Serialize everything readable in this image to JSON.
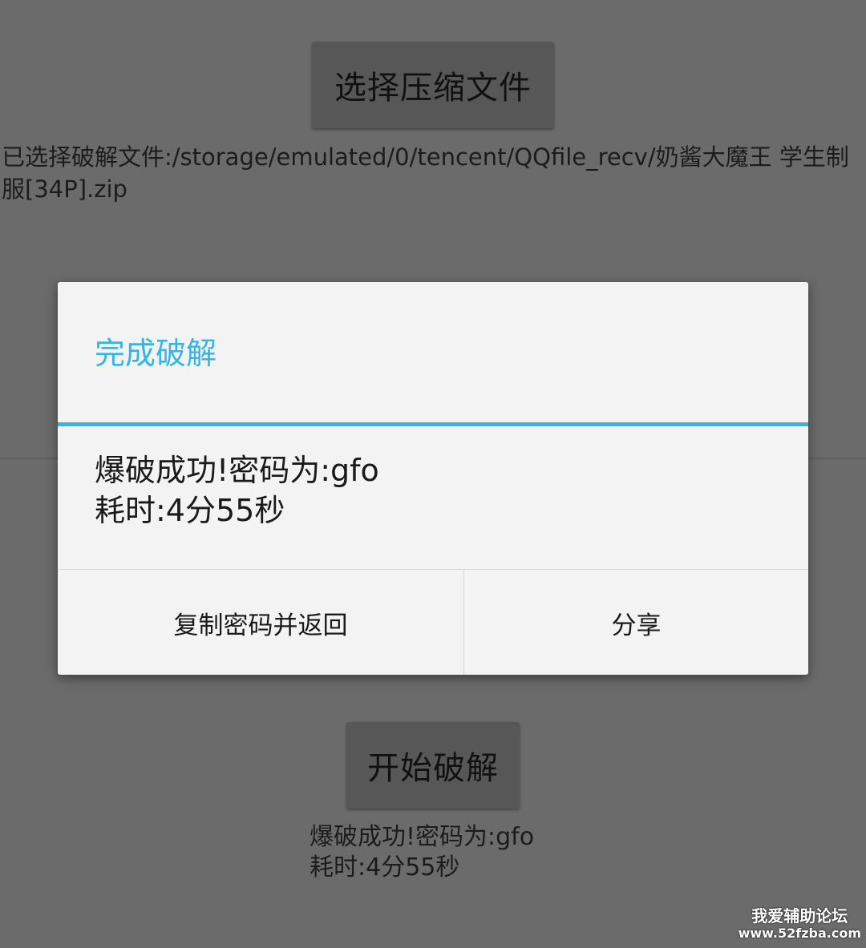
{
  "main": {
    "select_button_label": "选择压缩文件",
    "selected_file_text": "已选择破解文件:/storage/emulated/0/tencent/QQfile_recv/奶酱大魔王 学生制服[34P].zip",
    "start_button_label": "开始破解",
    "result_line1": "爆破成功!密码为:gfo",
    "result_line2": "耗时:4分55秒"
  },
  "dialog": {
    "title": "完成破解",
    "message_line1": "爆破成功!密码为:gfo",
    "message_line2": "耗时:4分55秒",
    "buttons": [
      {
        "label": "复制密码并返回"
      },
      {
        "label": "分享"
      }
    ],
    "accent_color": "#33b5e5"
  },
  "watermark": {
    "line1": "我爱辅助论坛",
    "line2": "www.52fzba.com"
  }
}
